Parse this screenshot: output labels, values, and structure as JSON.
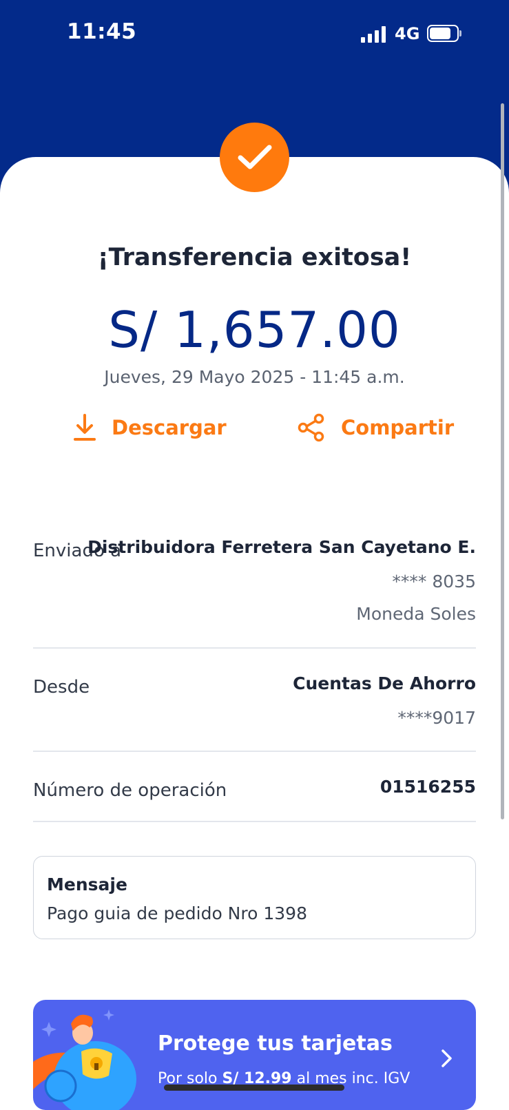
{
  "status_bar": {
    "time": "11:45",
    "network": "4G"
  },
  "receipt": {
    "title": "¡Transferencia exitosa!",
    "amount": "S/ 1,657.00",
    "datetime": "Jueves, 29 Mayo 2025 - 11:45 a.m."
  },
  "actions": {
    "download_label": "Descargar",
    "share_label": "Compartir"
  },
  "details": {
    "sent_to": {
      "label": "Enviado a",
      "name": "Distribuidora Ferretera San Cayetano E.",
      "account": "**** 8035",
      "currency": "Moneda Soles"
    },
    "from": {
      "label": "Desde",
      "account_type": "Cuentas De Ahorro",
      "account": "****9017"
    },
    "operation": {
      "label": "Número de operación",
      "number": "01516255"
    }
  },
  "message": {
    "title": "Mensaje",
    "text": "Pago guia de pedido Nro 1398"
  },
  "banner": {
    "title": "Protege tus tarjetas",
    "subtitle_prefix": "Por solo ",
    "subtitle_price": "S/ 12.99",
    "subtitle_suffix": " al mes inc. IGV"
  },
  "colors": {
    "header_blue": "#032a8a",
    "amount_blue": "#052886",
    "accent_orange": "#ff7a0d",
    "banner_blue": "#4f63ef"
  },
  "icons": [
    "check-icon",
    "download-icon",
    "share-icon",
    "chevron-right-icon",
    "signal-icon",
    "battery-icon"
  ]
}
